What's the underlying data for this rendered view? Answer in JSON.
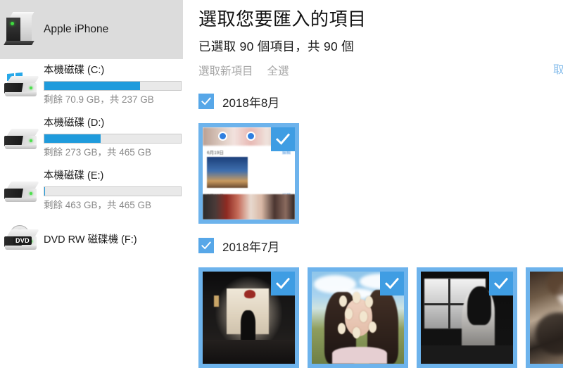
{
  "sidebar": {
    "device": {
      "name": "Apple iPhone",
      "icon": "portable-device-icon",
      "selected": true
    },
    "drives": [
      {
        "name": "本機磁碟 (C:)",
        "capacity_text": "剩餘 70.9 GB，共 237 GB",
        "free_gb": 70.9,
        "total_gb": 237,
        "used_percent": 70,
        "icon": "hard-drive-windows-icon",
        "bar_color": "#1f9bdc"
      },
      {
        "name": "本機磁碟 (D:)",
        "capacity_text": "剩餘 273 GB，共 465 GB",
        "free_gb": 273,
        "total_gb": 465,
        "used_percent": 41,
        "icon": "hard-drive-icon",
        "bar_color": "#1f9bdc"
      },
      {
        "name": "本機磁碟 (E:)",
        "capacity_text": "剩餘 463 GB，共 465 GB",
        "free_gb": 463,
        "total_gb": 465,
        "used_percent": 0,
        "icon": "hard-drive-icon",
        "bar_color": "#1f9bdc"
      }
    ],
    "optical": {
      "name": "DVD RW 磁碟機 (F:)",
      "icon": "dvd-drive-icon",
      "tag": "DVD"
    }
  },
  "main": {
    "title": "選取您要匯入的項目",
    "subtitle": "已選取 90 個項目，共 90 個",
    "selected_count": 90,
    "total_count": 90,
    "commands": {
      "select_new": "選取新項目",
      "select_all": "全選",
      "cancel": "取消"
    },
    "accent_color": "#1f9bdc",
    "checkbox_color": "#57a7e8",
    "thumb_border_color": "#6db3ec",
    "groups": [
      {
        "label": "2018年8月",
        "checked": true,
        "items": [
          {
            "art": "screenshot",
            "checked": true,
            "caption_top": "6月19日",
            "caption_bottom": "7月23日",
            "caption_right_top": "編輯",
            "caption_right_bottom": "編輯"
          }
        ]
      },
      {
        "label": "2018年7月",
        "checked": true,
        "items": [
          {
            "art": "cafe",
            "checked": true
          },
          {
            "art": "girl",
            "checked": true
          },
          {
            "art": "bw",
            "checked": true
          },
          {
            "art": "lace",
            "checked": false
          }
        ]
      }
    ]
  }
}
